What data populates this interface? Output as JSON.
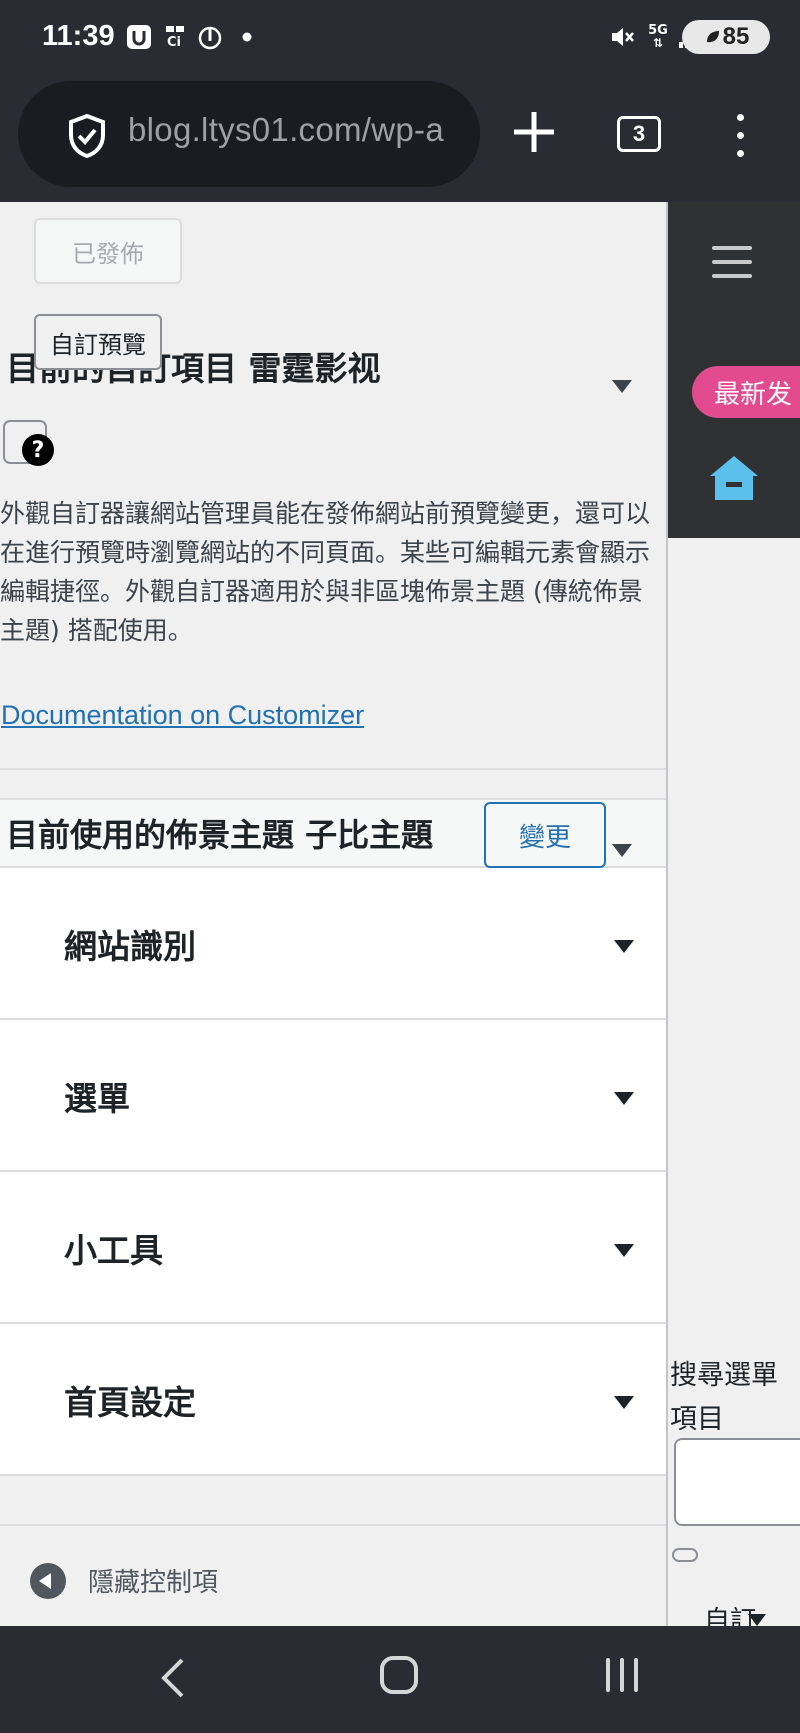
{
  "status_bar": {
    "time": "11:39",
    "battery": "85",
    "network": "5G",
    "icons": [
      "u-app-icon",
      "ci-icon",
      "flame-icon",
      "dot-icon",
      "mute-icon",
      "network-5g-icon",
      "signal-icon",
      "battery-icon"
    ]
  },
  "browser": {
    "url": "blog.ltys01.com/wp-a",
    "tab_count": "3"
  },
  "customizer": {
    "published_label": "已發佈",
    "preview_tooltip": "自訂預覽",
    "info_title": "目前的自訂項目 雷霆影视",
    "description": "外觀自訂器讓網站管理員能在發佈網站前預覽變更，還可以在進行預覽時瀏覽網站的不同頁面。某些可編輯元素會顯示編輯捷徑。外觀自訂器適用於與非區塊佈景主題 (傳統佈景主題) 搭配使用。",
    "doc_link": "Documentation on Customizer",
    "theme_title": "目前使用的佈景主題 子比主題",
    "change_label": "變更",
    "sections": [
      "網站識別",
      "選單",
      "小工具",
      "首頁設定"
    ],
    "hide_controls": "隱藏控制項"
  },
  "preview": {
    "pill_text": "最新发",
    "search_label": "搜尋選單項目",
    "cut_text": "自訂"
  },
  "colors": {
    "accent_blue": "#2271b1",
    "pill_pink": "#e34b8f",
    "home_icon": "#5bc0eb"
  }
}
